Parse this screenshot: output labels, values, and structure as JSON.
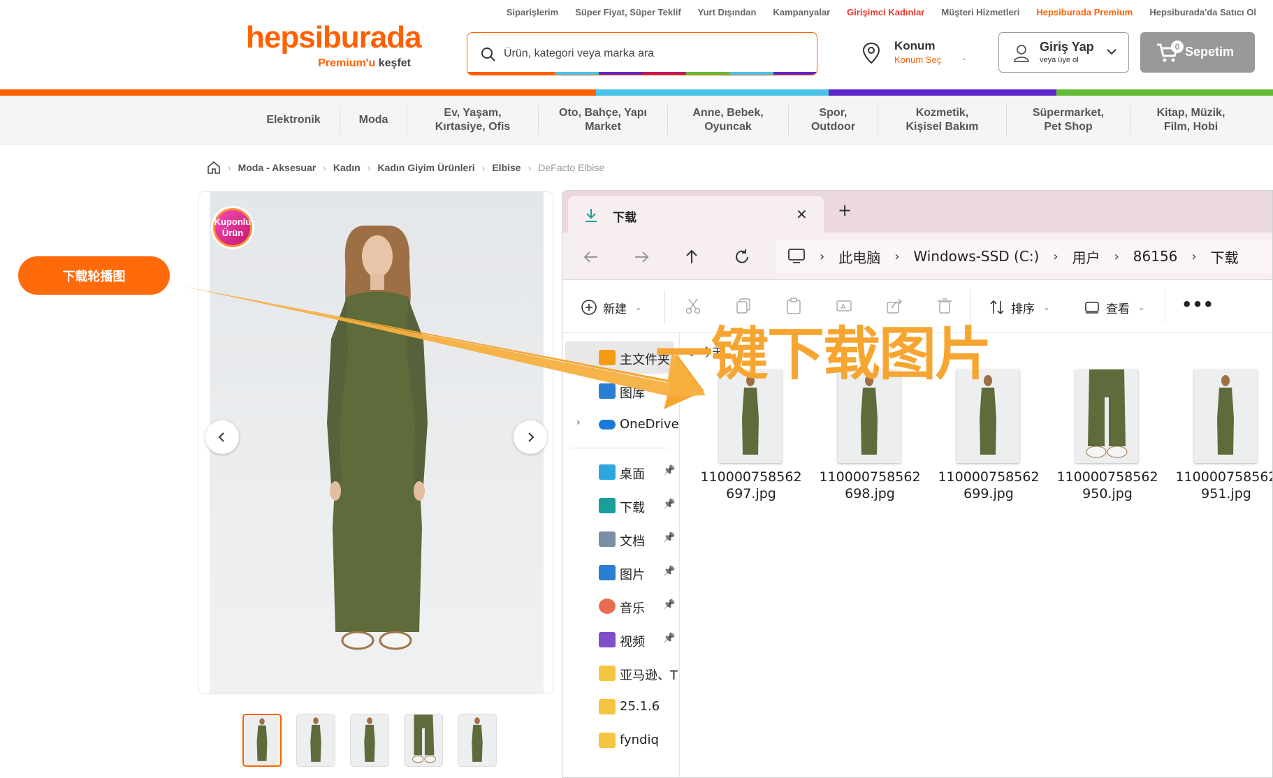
{
  "header": {
    "top_links": [
      {
        "label": "Siparişlerim",
        "color": "default"
      },
      {
        "label": "Süper Fiyat, Süper Teklif",
        "color": "default"
      },
      {
        "label": "Yurt Dışından",
        "color": "default"
      },
      {
        "label": "Kampanyalar",
        "color": "default"
      },
      {
        "label": "Girişimci Kadınlar",
        "color": "red"
      },
      {
        "label": "Müşteri Hizmetleri",
        "color": "default"
      },
      {
        "label": "Hepsiburada Premium",
        "color": "orange"
      },
      {
        "label": "Hepsiburada'da Satıcı Ol",
        "color": "default"
      }
    ],
    "logo_text": "hepsiburada",
    "logo_sub_orange": "Premium'u",
    "logo_sub_dark": "keşfet",
    "search_placeholder": "Ürün, kategori veya marka ara",
    "location_title": "Konum",
    "location_sub": "Konum Seç",
    "login_title": "Giriş Yap",
    "login_sub": "veya üye ol",
    "cart_label": "Sepetim",
    "cart_count": "0"
  },
  "categories": [
    "Elektronik",
    "Moda",
    "Ev, Yaşam,\nKırtasiye, Ofis",
    "Oto, Bahçe, Yapı\nMarket",
    "Anne, Bebek,\nOyuncak",
    "Spor,\nOutdoor",
    "Kozmetik,\nKişisel Bakım",
    "Süpermarket,\nPet Shop",
    "Kitap, Müzik,\nFilm, Hobi"
  ],
  "breadcrumb": [
    "Moda - Aksesuar",
    "Kadın",
    "Kadın Giyim Ürünleri",
    "Elbise",
    "DeFacto Elbise"
  ],
  "product": {
    "badge_line1": "Kuponlu",
    "badge_line2": "Ürün",
    "thumb_count": 5
  },
  "download_button": "下载轮播图",
  "overlay_text": "一键下载图片",
  "explorer": {
    "tab_title": "下载",
    "address": [
      "此电脑",
      "Windows-SSD (C:)",
      "用户",
      "86156",
      "下载"
    ],
    "commands": {
      "new": "新建",
      "sort": "排序",
      "view": "查看"
    },
    "sidebar": [
      {
        "label": "主文件夹",
        "icon": "home-icon",
        "pinned": false
      },
      {
        "label": "图库",
        "icon": "gallery-icon",
        "pinned": false
      },
      {
        "label": "OneDrive",
        "icon": "onedrive-icon",
        "pinned": false
      },
      {
        "label": "桌面",
        "icon": "desktop-icon",
        "pinned": true
      },
      {
        "label": "下载",
        "icon": "download-icon",
        "pinned": true
      },
      {
        "label": "文档",
        "icon": "documents-icon",
        "pinned": true
      },
      {
        "label": "图片",
        "icon": "pictures-icon",
        "pinned": true
      },
      {
        "label": "音乐",
        "icon": "music-icon",
        "pinned": true
      },
      {
        "label": "视频",
        "icon": "videos-icon",
        "pinned": true
      },
      {
        "label": "亚马逊、T",
        "icon": "folder-icon",
        "pinned": false
      },
      {
        "label": "25.1.6",
        "icon": "folder-icon",
        "pinned": false
      },
      {
        "label": "fyndiq",
        "icon": "folder-icon",
        "pinned": false
      }
    ],
    "section_label": "今天",
    "files": [
      {
        "line1": "110000758562",
        "line2": "697.jpg"
      },
      {
        "line1": "110000758562",
        "line2": "698.jpg"
      },
      {
        "line1": "110000758562",
        "line2": "699.jpg"
      },
      {
        "line1": "110000758562",
        "line2": "950.jpg"
      },
      {
        "line1": "110000758562",
        "line2": "951.jpg"
      }
    ]
  },
  "colors": {
    "brand_orange": "#ff6000",
    "bar_orange": "#ff6000",
    "bar_blue": "#4bc3e8",
    "bar_purple": "#5f25c9",
    "bar_green": "#64bc36",
    "dress_green": "#5e6b3b",
    "arrow_yellow": "#f7a531"
  }
}
